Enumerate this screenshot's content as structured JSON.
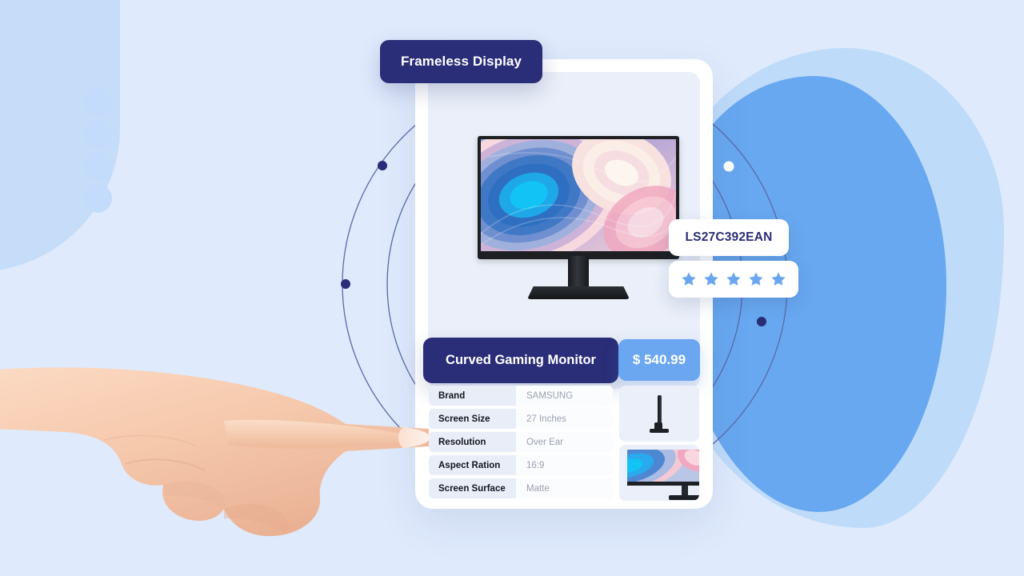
{
  "badges": {
    "feature_label": "Frameless Display",
    "model_code": "LS27C392EAN",
    "rating_stars": 5,
    "rating_star_color": "#6ba6f0"
  },
  "product": {
    "title": "Curved Gaming Monitor",
    "price": "$ 540.99",
    "title_bar_color": "#2a2d77",
    "price_badge_color": "#6ba6f0"
  },
  "specs": [
    {
      "label": "Brand",
      "value": "SAMSUNG"
    },
    {
      "label": "Screen Size",
      "value": "27 Inches"
    },
    {
      "label": "Resolution",
      "value": "Over Ear"
    },
    {
      "label": "Aspect Ration",
      "value": "16:9"
    },
    {
      "label": "Screen Surface",
      "value": "Matte"
    }
  ],
  "thumbnails": [
    {
      "name": "monitor-side-profile-thumbnail"
    },
    {
      "name": "monitor-angled-view-thumbnail"
    }
  ],
  "theme": {
    "background": "#dfeafc",
    "card_background": "#ffffff",
    "image_panel_background": "#eaeff9",
    "navy": "#2a2d77",
    "blue": "#6ba6f0",
    "spec_label_background": "#e9edf8",
    "spec_value_color": "#9ba1ae"
  },
  "decor": {
    "dot_count": 4,
    "orbit_count": 2,
    "orbit_markers": 4
  }
}
